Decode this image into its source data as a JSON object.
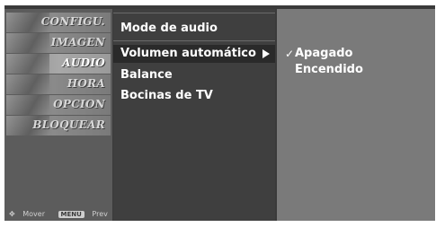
{
  "sidebar": {
    "items": [
      {
        "label": "CONFIGU."
      },
      {
        "label": "IMAGEN"
      },
      {
        "label": "AUDIO"
      },
      {
        "label": "HORA"
      },
      {
        "label": "OPCION"
      },
      {
        "label": "BLOQUEAR"
      }
    ],
    "footer": {
      "move_label": "Mover",
      "menu_key": "MENU",
      "prev_label": "Prev"
    }
  },
  "submenu": {
    "items": [
      {
        "label": "Mode de audio"
      },
      {
        "label": "Volumen automático"
      },
      {
        "label": "Balance"
      },
      {
        "label": "Bocinas de TV"
      }
    ]
  },
  "options": {
    "check_icon": "check-icon",
    "items": [
      {
        "label": "Apagado"
      },
      {
        "label": "Encendido"
      }
    ]
  }
}
